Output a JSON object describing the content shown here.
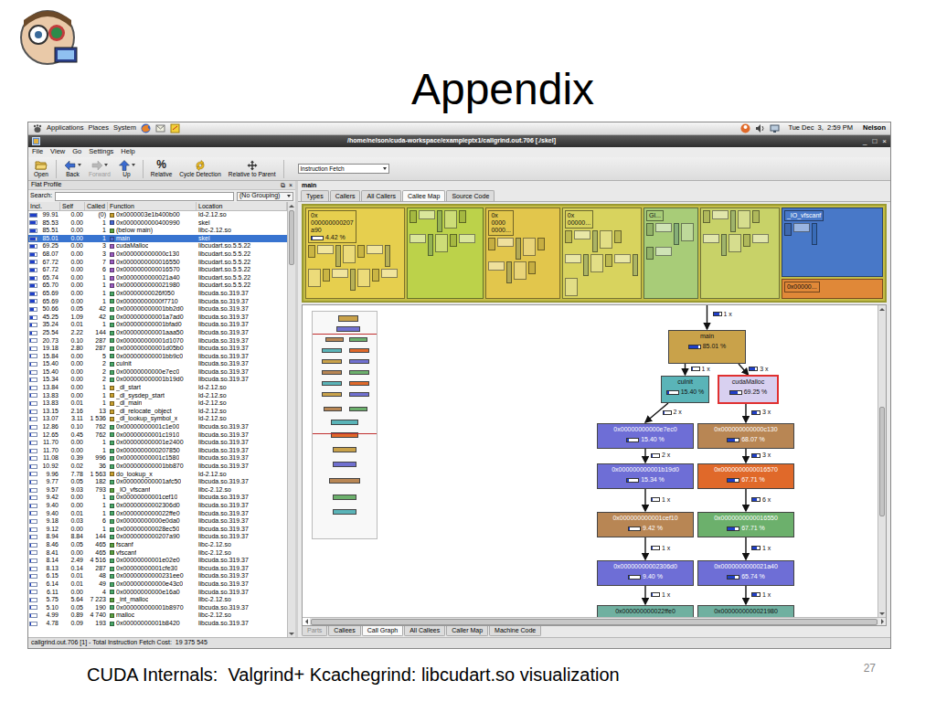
{
  "slide": {
    "title": "Appendix",
    "caption": "CUDA Internals:  Valgrind+ Kcachegrind: libcudart.so visualization",
    "page_number": "27"
  },
  "desktop_panel": {
    "menus": [
      "Applications",
      "Places",
      "System"
    ],
    "clock": "Tue Dec  3,  2:59 PM",
    "user": "Nelson"
  },
  "window": {
    "title": "/home/nelson/cuda-workspace/exampleptx1/callgrind.out.706 [./skel]",
    "controls": [
      "_",
      "□",
      "×"
    ]
  },
  "menubar": [
    "File",
    "View",
    "Go",
    "Settings",
    "Help"
  ],
  "toolbar": {
    "buttons": [
      {
        "label": "Open",
        "kind": "open",
        "disabled": false
      },
      {
        "label": "Back",
        "kind": "back",
        "disabled": false
      },
      {
        "label": "Forward",
        "kind": "forward",
        "disabled": true
      },
      {
        "label": "Up",
        "kind": "up",
        "disabled": false
      },
      {
        "label": "Relative",
        "kind": "relative",
        "glyph": "%",
        "disabled": false
      },
      {
        "label": "Cycle Detection",
        "kind": "cycle",
        "disabled": false
      },
      {
        "label": "Relative to Parent",
        "kind": "parent",
        "disabled": false
      }
    ],
    "combo": "Instruction Fetch"
  },
  "flat_profile": {
    "title": "Flat Profile",
    "controls": [
      "⧉",
      "×"
    ],
    "search_label": "Search:",
    "search_value": "",
    "grouping": "(No Grouping)",
    "columns": [
      "Incl.",
      "Self",
      "Called",
      "Function",
      "Location"
    ],
    "rows": [
      {
        "incl": "99.91",
        "self": "0.00",
        "called": "(0)",
        "function": "0x0000003e1b400b00",
        "location": "ld-2.12.so",
        "color": "#c8a030",
        "selected": false
      },
      {
        "incl": "85.53",
        "self": "0.00",
        "called": "1",
        "function": "0x0000000000400990",
        "location": "skel",
        "color": "#4a6ad0",
        "selected": false
      },
      {
        "incl": "85.51",
        "self": "0.00",
        "called": "1",
        "function": "(below main)",
        "location": "libc-2.12.so",
        "color": "#5aa040",
        "selected": false
      },
      {
        "incl": "85.01",
        "self": "0.00",
        "called": "1",
        "function": "main",
        "location": "skel",
        "color": "#4a6ad0",
        "selected": true
      },
      {
        "incl": "69.25",
        "self": "0.00",
        "called": "3",
        "function": "cudaMalloc",
        "location": "libcudart.so.5.5.22",
        "color": "#9a5cc0",
        "selected": false
      },
      {
        "incl": "68.07",
        "self": "0.00",
        "called": "3",
        "function": "0x000000000000c130",
        "location": "libcudart.so.5.5.22",
        "color": "#9a5cc0",
        "selected": false
      },
      {
        "incl": "67.72",
        "self": "0.00",
        "called": "7",
        "function": "0x0000000000016550",
        "location": "libcudart.so.5.5.22",
        "color": "#9a5cc0",
        "selected": false
      },
      {
        "incl": "67.72",
        "self": "0.00",
        "called": "6",
        "function": "0x0000000000016570",
        "location": "libcudart.so.5.5.22",
        "color": "#9a5cc0",
        "selected": false
      },
      {
        "incl": "65.74",
        "self": "0.00",
        "called": "1",
        "function": "0x0000000000021a40",
        "location": "libcudart.so.5.5.22",
        "color": "#9a5cc0",
        "selected": false
      },
      {
        "incl": "65.70",
        "self": "0.00",
        "called": "1",
        "function": "0x0000000000021980",
        "location": "libcudart.so.5.5.22",
        "color": "#9a5cc0",
        "selected": false
      },
      {
        "incl": "65.69",
        "self": "0.00",
        "called": "1",
        "function": "0x00000000026f050",
        "location": "libcuda.so.319.37",
        "color": "#4aa868",
        "selected": false
      },
      {
        "incl": "65.69",
        "self": "0.00",
        "called": "1",
        "function": "0x00000000000f7710",
        "location": "libcuda.so.319.37",
        "color": "#4aa868",
        "selected": false
      },
      {
        "incl": "50.66",
        "self": "0.05",
        "called": "42",
        "function": "0x000000000001bb2d0",
        "location": "libcuda.so.319.37",
        "color": "#4aa868",
        "selected": false
      },
      {
        "incl": "45.25",
        "self": "1.09",
        "called": "42",
        "function": "0x000000000001a7ad0",
        "location": "libcuda.so.319.37",
        "color": "#4aa868",
        "selected": false
      },
      {
        "incl": "35.24",
        "self": "0.01",
        "called": "1",
        "function": "0x000000000001bfad0",
        "location": "libcuda.so.319.37",
        "color": "#4aa868",
        "selected": false
      },
      {
        "incl": "25.54",
        "self": "2.22",
        "called": "144",
        "function": "0x000000000001aaa50",
        "location": "libcuda.so.319.37",
        "color": "#4aa868",
        "selected": false
      },
      {
        "incl": "20.73",
        "self": "0.10",
        "called": "287",
        "function": "0x000000000001d1070",
        "location": "libcuda.so.319.37",
        "color": "#4aa868",
        "selected": false
      },
      {
        "incl": "19.18",
        "self": "2.80",
        "called": "287",
        "function": "0x000000000001d05b0",
        "location": "libcuda.so.319.37",
        "color": "#4aa868",
        "selected": false
      },
      {
        "incl": "15.84",
        "self": "0.00",
        "called": "5",
        "function": "0x000000000001bb9c0",
        "location": "libcuda.so.319.37",
        "color": "#4aa868",
        "selected": false
      },
      {
        "incl": "15.40",
        "self": "0.00",
        "called": "2",
        "function": "cuInit",
        "location": "libcuda.so.319.37",
        "color": "#4aa868",
        "selected": false
      },
      {
        "incl": "15.40",
        "self": "0.00",
        "called": "2",
        "function": "0x00000000000e7ec0",
        "location": "libcuda.so.319.37",
        "color": "#4aa868",
        "selected": false
      },
      {
        "incl": "15.34",
        "self": "0.00",
        "called": "2",
        "function": "0x000000000001b19d0",
        "location": "libcuda.so.319.37",
        "color": "#4aa868",
        "selected": false
      },
      {
        "incl": "13.84",
        "self": "0.00",
        "called": "1",
        "function": "_dl_start",
        "location": "ld-2.12.so",
        "color": "#c8a030",
        "selected": false
      },
      {
        "incl": "13.83",
        "self": "0.00",
        "called": "1",
        "function": "_dl_sysdep_start",
        "location": "ld-2.12.so",
        "color": "#c8a030",
        "selected": false
      },
      {
        "incl": "13.83",
        "self": "0.01",
        "called": "1",
        "function": "_dl_main",
        "location": "ld-2.12.so",
        "color": "#c8a030",
        "selected": false
      },
      {
        "incl": "13.15",
        "self": "2.16",
        "called": "13",
        "function": "_dl_relocate_object",
        "location": "ld-2.12.so",
        "color": "#c8a030",
        "selected": false
      },
      {
        "incl": "13.07",
        "self": "3.11",
        "called": "1 536",
        "function": "_dl_lookup_symbol_x",
        "location": "ld-2.12.so",
        "color": "#c8a030",
        "selected": false
      },
      {
        "incl": "12.86",
        "self": "0.10",
        "called": "762",
        "function": "0x00000000001c1e00",
        "location": "libcuda.so.319.37",
        "color": "#4aa868",
        "selected": false
      },
      {
        "incl": "12.65",
        "self": "0.45",
        "called": "762",
        "function": "0x00000000001c1910",
        "location": "libcuda.so.319.37",
        "color": "#4aa868",
        "selected": false
      },
      {
        "incl": "11.70",
        "self": "0.00",
        "called": "1",
        "function": "0x000000000001e2400",
        "location": "libcuda.so.319.37",
        "color": "#4aa868",
        "selected": false
      },
      {
        "incl": "11.70",
        "self": "0.00",
        "called": "1",
        "function": "0x0000000000207850",
        "location": "libcuda.so.319.37",
        "color": "#4aa868",
        "selected": false
      },
      {
        "incl": "11.08",
        "self": "0.39",
        "called": "996",
        "function": "0x00000000001c1580",
        "location": "libcuda.so.319.37",
        "color": "#4aa868",
        "selected": false
      },
      {
        "incl": "10.92",
        "self": "0.02",
        "called": "36",
        "function": "0x000000000001bb870",
        "location": "libcuda.so.319.37",
        "color": "#4aa868",
        "selected": false
      },
      {
        "incl": "9.96",
        "self": "7.78",
        "called": "1 563",
        "function": "do_lookup_x",
        "location": "ld-2.12.so",
        "color": "#c8a030",
        "selected": false
      },
      {
        "incl": "9.77",
        "self": "0.05",
        "called": "182",
        "function": "0x000000000001afc50",
        "location": "libcuda.so.319.37",
        "color": "#4aa868",
        "selected": false
      },
      {
        "incl": "9.57",
        "self": "9.03",
        "called": "793",
        "function": "_IO_vfscanf",
        "location": "libc-2.12.so",
        "color": "#5aa040",
        "selected": false
      },
      {
        "incl": "9.42",
        "self": "0.00",
        "called": "1",
        "function": "0x00000000001cef10",
        "location": "libcuda.so.319.37",
        "color": "#4aa868",
        "selected": false
      },
      {
        "incl": "9.40",
        "self": "0.00",
        "called": "1",
        "function": "0x00000000002306d0",
        "location": "libcuda.so.319.37",
        "color": "#4aa868",
        "selected": false
      },
      {
        "incl": "9.40",
        "self": "0.01",
        "called": "1",
        "function": "0x0000000000022ffe0",
        "location": "libcuda.so.319.37",
        "color": "#4aa868",
        "selected": false
      },
      {
        "incl": "9.18",
        "self": "0.03",
        "called": "6",
        "function": "0x00000000000e0da0",
        "location": "libcuda.so.319.37",
        "color": "#4aa868",
        "selected": false
      },
      {
        "incl": "9.12",
        "self": "0.00",
        "called": "1",
        "function": "0x000000000028ec50",
        "location": "libcuda.so.319.37",
        "color": "#4aa868",
        "selected": false
      },
      {
        "incl": "8.94",
        "self": "8.84",
        "called": "144",
        "function": "0x0000000000207a90",
        "location": "libcuda.so.319.37",
        "color": "#4aa868",
        "selected": false
      },
      {
        "incl": "8.46",
        "self": "0.05",
        "called": "465",
        "function": "fscanf",
        "location": "libc-2.12.so",
        "color": "#5aa040",
        "selected": false
      },
      {
        "incl": "8.41",
        "self": "0.00",
        "called": "465",
        "function": "vfscanf",
        "location": "libc-2.12.so",
        "color": "#5aa040",
        "selected": false
      },
      {
        "incl": "8.14",
        "self": "2.49",
        "called": "4 516",
        "function": "0x00000000001e02e0",
        "location": "libcuda.so.319.37",
        "color": "#4aa868",
        "selected": false
      },
      {
        "incl": "8.13",
        "self": "0.14",
        "called": "287",
        "function": "0x00000000001cfe30",
        "location": "libcuda.so.319.37",
        "color": "#4aa868",
        "selected": false
      },
      {
        "incl": "6.15",
        "self": "0.01",
        "called": "48",
        "function": "0x00000000000231ee0",
        "location": "libcuda.so.319.37",
        "color": "#4aa868",
        "selected": false
      },
      {
        "incl": "6.14",
        "self": "0.01",
        "called": "49",
        "function": "0x000000000000e43c0",
        "location": "libcuda.so.319.37",
        "color": "#4aa868",
        "selected": false
      },
      {
        "incl": "6.11",
        "self": "0.00",
        "called": "4",
        "function": "0x00000000000e16a0",
        "location": "libcuda.so.319.37",
        "color": "#4aa868",
        "selected": false
      },
      {
        "incl": "5.75",
        "self": "5.64",
        "called": "7 223",
        "function": "_int_malloc",
        "location": "libc-2.12.so",
        "color": "#5aa040",
        "selected": false
      },
      {
        "incl": "5.10",
        "self": "0.05",
        "called": "190",
        "function": "0x000000000001b8970",
        "location": "libcuda.so.319.37",
        "color": "#4aa868",
        "selected": false
      },
      {
        "incl": "4.99",
        "self": "0.89",
        "called": "4 740",
        "function": "malloc",
        "location": "libc-2.12.so",
        "color": "#5aa040",
        "selected": false
      },
      {
        "incl": "4.78",
        "self": "0.09",
        "called": "193",
        "function": "0x00000000001b8420",
        "location": "libcuda.so.319.37",
        "color": "#4aa868",
        "selected": false
      }
    ]
  },
  "detail": {
    "function": "main",
    "tabs": [
      {
        "label": "Types",
        "selected": false
      },
      {
        "label": "Callers",
        "selected": false
      },
      {
        "label": "All Callers",
        "selected": false
      },
      {
        "label": "Callee Map",
        "selected": true
      },
      {
        "label": "Source Code",
        "selected": false
      }
    ],
    "bottom_tabs": [
      {
        "label": "Parts",
        "selected": false,
        "disabled": true
      },
      {
        "label": "Callees",
        "selected": false,
        "disabled": false
      },
      {
        "label": "Call Graph",
        "selected": true,
        "disabled": false
      },
      {
        "label": "All Callees",
        "selected": false,
        "disabled": false
      },
      {
        "label": "Caller Map",
        "selected": false,
        "disabled": false
      },
      {
        "label": "Machine Code",
        "selected": false,
        "disabled": false
      }
    ]
  },
  "treemap": {
    "cells": [
      {
        "lines": [
          "0x",
          "000000000207",
          "a90"
        ],
        "reading": "4.42 %",
        "level": 0.05,
        "color": "#e6cf4e"
      },
      {
        "lines": [],
        "color": "#bcd24a"
      },
      {
        "lines": [
          "0x",
          "0000",
          "0000..."
        ],
        "color": "#e2c64c"
      },
      {
        "lines": [
          "0x",
          "00000..."
        ],
        "color": "#d8d35e"
      },
      {
        "lines": [
          "Gl..."
        ],
        "color": "#a8cc78"
      },
      {
        "lines": [],
        "color": "#c8d268"
      },
      {
        "lines": [
          "_IO_vfscanf"
        ],
        "color": "#4878c8"
      },
      {
        "lines": [
          "0x00000..."
        ],
        "color": "#e08838"
      }
    ]
  },
  "call_graph": {
    "nodes": [
      {
        "name": "main",
        "percent": "85.01 %",
        "level": 0.85,
        "color": "#c9a24a",
        "selected": false
      },
      {
        "name": "cuInit",
        "percent": "15.40 %",
        "level": 0.154,
        "color": "#5ab4b8",
        "selected": false
      },
      {
        "name": "cudaMalloc",
        "percent": "69.25 %",
        "level": 0.6925,
        "color": "#d8d0f0",
        "selected": true
      },
      {
        "name": "0x00000000000e7ec0",
        "percent": "15.40 %",
        "level": 0.154,
        "color": "#6e6ed6",
        "selected": false
      },
      {
        "name": "0x000000000000c130",
        "percent": "68.07 %",
        "level": 0.6807,
        "color": "#b88654",
        "selected": false
      },
      {
        "name": "0x000000000001b19d0",
        "percent": "15.34 %",
        "level": 0.1534,
        "color": "#6e6ed6",
        "selected": false
      },
      {
        "name": "0x0000000000016570",
        "percent": "67.71 %",
        "level": 0.6771,
        "color": "#e0692a",
        "selected": false
      },
      {
        "name": "0x000000000001cef10",
        "percent": "9.42 %",
        "level": 0.0942,
        "color": "#b88654",
        "selected": false
      },
      {
        "name": "0x0000000000016550",
        "percent": "67.71 %",
        "level": 0.6771,
        "color": "#6cb06c",
        "selected": false
      },
      {
        "name": "0x00000000002306d0",
        "percent": "9.40 %",
        "level": 0.094,
        "color": "#6e6ed6",
        "selected": false
      },
      {
        "name": "0x0000000000021a40",
        "percent": "65.74 %",
        "level": 0.6574,
        "color": "#6e6ed6",
        "selected": false
      },
      {
        "name": "0x000000000022ffe0",
        "color": "#70b0a0",
        "selected": false
      },
      {
        "name": "0x0000000000021980",
        "color": "#70b0a0",
        "selected": false
      }
    ],
    "edges": [
      {
        "from": null,
        "to": "main",
        "label": "1 x",
        "level": 0.85
      },
      {
        "from": "main",
        "to": "cuInit",
        "label": "1 x",
        "level": 0.15
      },
      {
        "from": "main",
        "to": "cudaMalloc",
        "label": "3 x",
        "level": 0.69
      },
      {
        "from": "cuInit",
        "to": "0x00000000000e7ec0",
        "label": "2 x",
        "level": 0.15
      },
      {
        "from": "cudaMalloc",
        "to": "0x000000000000c130",
        "label": "3 x",
        "level": 0.68
      },
      {
        "from": "0x00000000000e7ec0",
        "to": "0x000000000001b19d0",
        "label": "2 x",
        "level": 0.15
      },
      {
        "from": "0x000000000000c130",
        "to": "0x0000000000016570",
        "label": "3 x",
        "level": 0.68
      },
      {
        "from": "0x000000000001b19d0",
        "to": "0x000000000001cef10",
        "label": "1 x",
        "level": 0.09
      },
      {
        "from": "0x0000000000016570",
        "to": "0x0000000000016550",
        "label": "6 x",
        "level": 0.68
      },
      {
        "from": "0x000000000001cef10",
        "to": "0x00000000002306d0",
        "label": "1 x",
        "level": 0.09
      },
      {
        "from": "0x0000000000016550",
        "to": "0x0000000000021a40",
        "label": "1 x",
        "level": 0.66
      },
      {
        "from": "0x00000000002306d0",
        "to": "0x000000000022ffe0",
        "label": "1 x",
        "level": 0.09
      },
      {
        "from": "0x0000000000021a40",
        "to": "0x0000000000021980",
        "label": "1 x",
        "level": 0.66
      }
    ]
  },
  "status_bar": "callgrind.out.706 [1] - Total Instruction Fetch Cost:  19 375 545"
}
